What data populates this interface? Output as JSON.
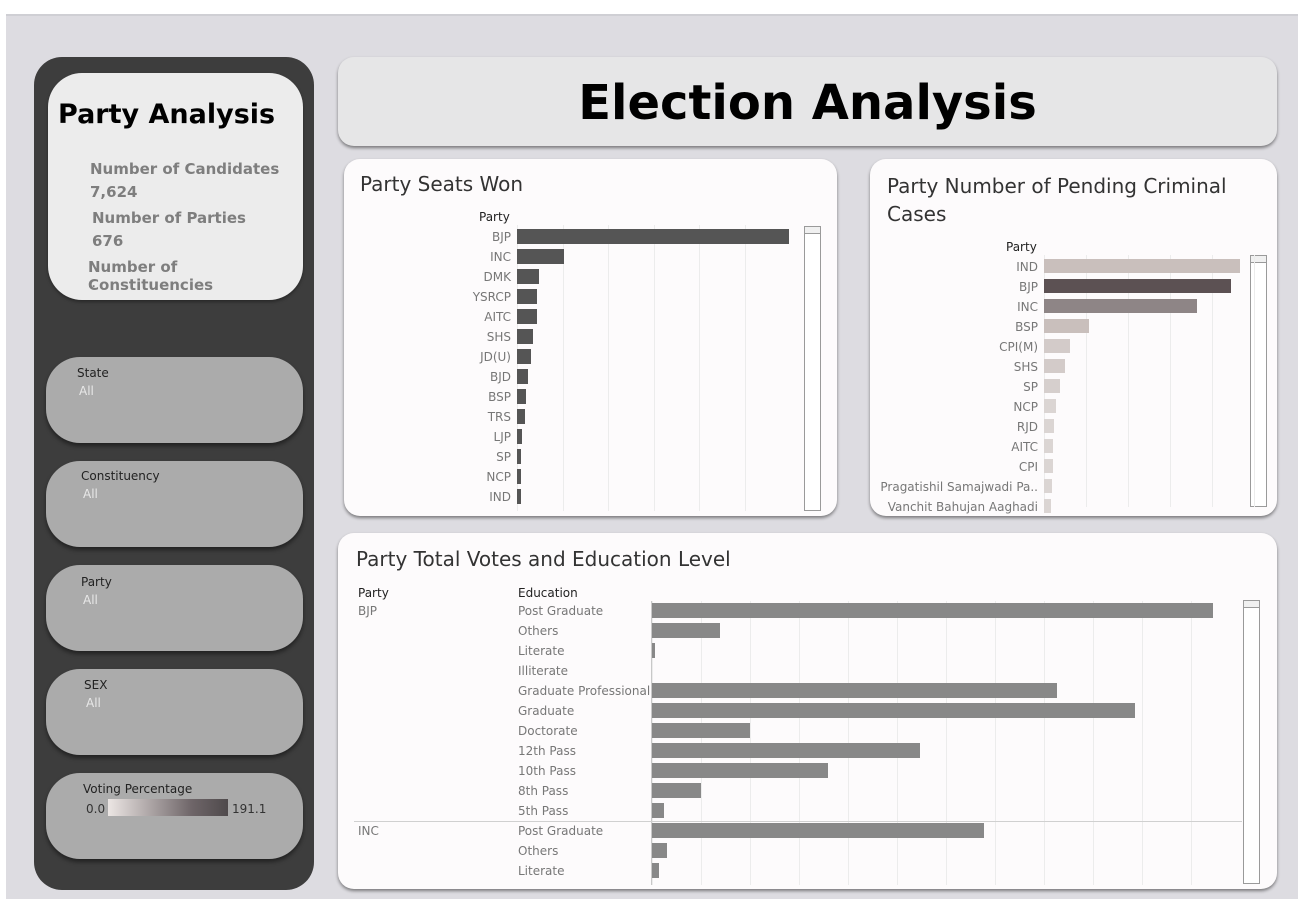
{
  "header": {
    "title": "Election Analysis"
  },
  "sidebar": {
    "title": "Party Analysis",
    "kpis": [
      {
        "label": "Number of Candidates",
        "value": "7,624"
      },
      {
        "label": "Number of Parties",
        "value": "676"
      },
      {
        "label": "Number of Constituencies",
        "value": ".."
      }
    ],
    "filters": [
      {
        "label": "State",
        "value": "All"
      },
      {
        "label": "Constituency",
        "value": "All"
      },
      {
        "label": "Party",
        "value": "All"
      },
      {
        "label": "SEX",
        "value": "All"
      }
    ],
    "voting_percentage": {
      "label": "Voting Percentage",
      "min": "0.0",
      "max": "191.1"
    }
  },
  "seats_panel": {
    "title": "Party Seats Won",
    "axis_header": "Party",
    "bar_color": "#555555"
  },
  "criminal_panel": {
    "title_line1": "Party Number of Pending Criminal",
    "title_line2": "Cases",
    "axis_header": "Party"
  },
  "votes_panel": {
    "title": "Party Total Votes and Education Level",
    "col_party": "Party",
    "col_education": "Education",
    "bar_color": "#888888"
  },
  "chart_data": [
    {
      "type": "bar",
      "title": "Party Seats Won",
      "ylabel": "Party",
      "categories": [
        "BJP",
        "INC",
        "DMK",
        "YSRCP",
        "AITC",
        "SHS",
        "JD(U)",
        "BJD",
        "BSP",
        "TRS",
        "LJP",
        "SP",
        "NCP",
        "IND"
      ],
      "values": [
        303,
        52,
        24,
        22,
        22,
        18,
        16,
        12,
        10,
        9,
        6,
        5,
        5,
        4
      ]
    },
    {
      "type": "bar",
      "title": "Party Number of Pending Criminal Cases",
      "ylabel": "Party",
      "categories": [
        "IND",
        "BJP",
        "INC",
        "BSP",
        "CPI(M)",
        "SHS",
        "SP",
        "NCP",
        "RJD",
        "AITC",
        "CPI",
        "Pragatishil Samajwadi Pa..",
        "Vanchit Bahujan Aaghadi"
      ],
      "values": [
        1450,
        1380,
        1135,
        335,
        195,
        155,
        120,
        90,
        75,
        70,
        65,
        60,
        55
      ],
      "colors": [
        "#c9bfbc",
        "#5c5153",
        "#8e8586",
        "#c9bfbc",
        "#d3cbc9",
        "#d3cbc9",
        "#d6cfcd",
        "#dbd5d3",
        "#dbd5d3",
        "#dbd5d3",
        "#dbd5d3",
        "#dbd5d3",
        "#dbd5d3"
      ]
    },
    {
      "type": "bar",
      "title": "Party Total Votes and Education Level",
      "groups": [
        {
          "party": "BJP",
          "rows": [
            {
              "education": "Post Graduate",
              "value": 115
            },
            {
              "education": "Others",
              "value": 14
            },
            {
              "education": "Literate",
              "value": 0.5
            },
            {
              "education": "Illiterate",
              "value": 0
            },
            {
              "education": "Graduate Professional",
              "value": 83
            },
            {
              "education": "Graduate",
              "value": 99
            },
            {
              "education": "Doctorate",
              "value": 20
            },
            {
              "education": "12th Pass",
              "value": 55
            },
            {
              "education": "10th Pass",
              "value": 36
            },
            {
              "education": "8th Pass",
              "value": 10
            },
            {
              "education": "5th Pass",
              "value": 2.5
            }
          ]
        },
        {
          "party": "INC",
          "rows": [
            {
              "education": "Post Graduate",
              "value": 68
            },
            {
              "education": "Others",
              "value": 3
            },
            {
              "education": "Literate",
              "value": 1.5
            }
          ]
        }
      ],
      "xlim": [
        0,
        120
      ]
    }
  ]
}
